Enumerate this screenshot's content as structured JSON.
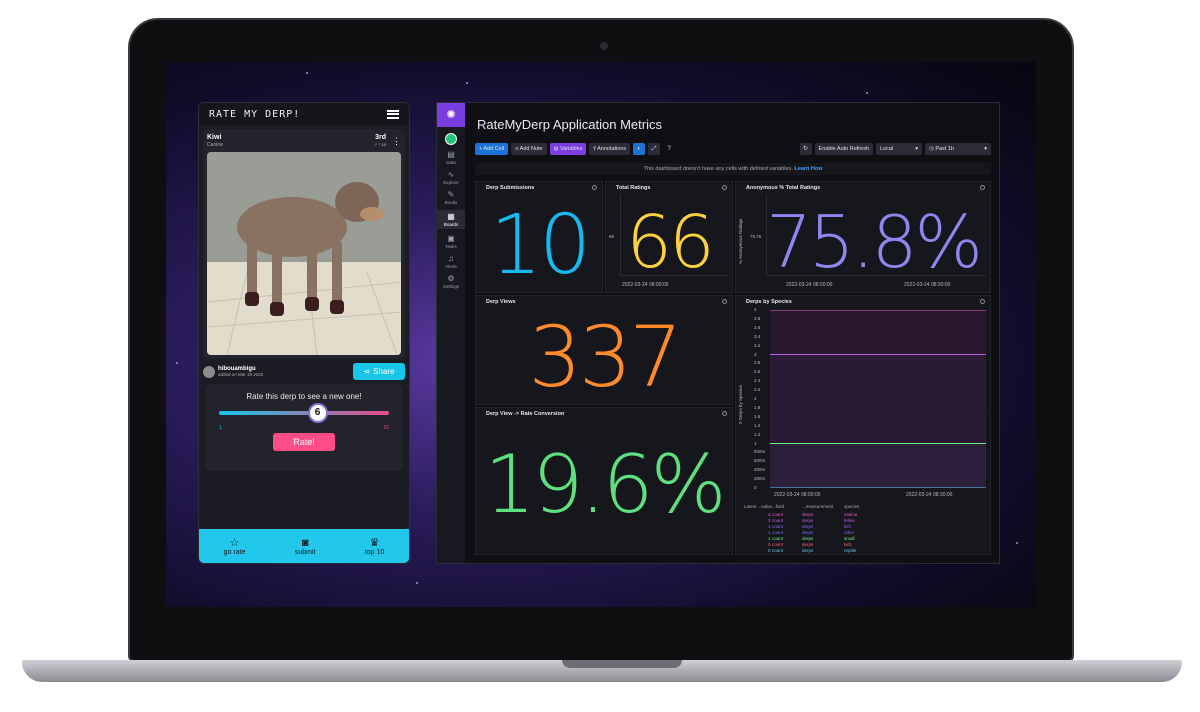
{
  "app": {
    "brand": "RATE MY DERP!",
    "pet": {
      "name": "Kiwi",
      "species": "Canine",
      "rank": "3rd",
      "rank_sub": "↗ 7.48"
    },
    "owner": {
      "name": "hibouambigu",
      "date": "added on Mar 19 2022"
    },
    "share_label": "Share",
    "rate_prompt": "Rate this derp to see a new one!",
    "rating_value": "6",
    "rating_fraction": 0.56,
    "slider_min": "1",
    "slider_max": "10",
    "rate_button": "Rate!",
    "tabs": [
      {
        "label": "go rate",
        "icon": "star-icon"
      },
      {
        "label": "submit",
        "icon": "camera-icon"
      },
      {
        "label": "top 10",
        "icon": "trophy-icon"
      }
    ]
  },
  "dashboard": {
    "title": "RateMyDerp Application Metrics",
    "nav": [
      {
        "label": "Data",
        "icon": "database-icon"
      },
      {
        "label": "Explore",
        "icon": "graph-icon"
      },
      {
        "label": "Books",
        "icon": "notebook-icon"
      },
      {
        "label": "Boards",
        "icon": "dashboard-icon"
      },
      {
        "label": "Tasks",
        "icon": "calendar-icon"
      },
      {
        "label": "Alerts",
        "icon": "bell-icon"
      },
      {
        "label": "Settings",
        "icon": "wrench-icon"
      }
    ],
    "toolbar": {
      "add_cell": "Add Cell",
      "add_note": "Add Note",
      "variables": "Variables",
      "annotations": "Annotations",
      "auto_refresh": "Enable Auto Refresh",
      "timezone": "Local",
      "range": "Past 1h"
    },
    "notice": "This dashboard doesn't have any cells with defined variables.",
    "notice_link": "Learn How",
    "cells": {
      "submissions": {
        "title": "Derp Submissions",
        "value": "10",
        "color": "#18b8f0"
      },
      "total_ratings": {
        "title": "Total Ratings",
        "value": "66",
        "color": "#ffd23d",
        "y_tick": "66",
        "x_tick": "2022-03-24 08:00:00"
      },
      "anon_pct": {
        "title": "Anonymous % Total Ratings",
        "value": "75.8%",
        "color": "#8f86f0",
        "ylabel": "% Anonymous Ratings",
        "y_tick": "75.76",
        "x_tick1": "2022-03-24 08:00:00",
        "x_tick2": "2022-03-24 08:30:00"
      },
      "views": {
        "title": "Derp Views",
        "value": "337",
        "color": "#ff8a2b"
      },
      "conversion": {
        "title": "Derp View -> Rate Conversion",
        "value": "19.6%",
        "color": "#5fe07e"
      },
      "species": {
        "title": "Derps by Species",
        "ylabel": "# Derps by Species",
        "y_ticks": [
          "4",
          "3.8",
          "3.6",
          "3.4",
          "3.2",
          "3",
          "2.8",
          "2.6",
          "2.4",
          "2.2",
          "2",
          "1.8",
          "1.6",
          "1.4",
          "1.2",
          "1",
          "800m",
          "600m",
          "400m",
          "200m",
          "0"
        ],
        "x_tick1": "2022-03-24 08:00:00",
        "x_tick2": "2022-03-24 08:30:00",
        "legend_headers": [
          "Latest ...value",
          "...field",
          "...measurement",
          "species"
        ],
        "legend": [
          {
            "value": "4",
            "field": "count",
            "measurement": "derps",
            "species": "canine",
            "color": "#e85cc8"
          },
          {
            "value": "3",
            "field": "count",
            "measurement": "derps",
            "species": "feline",
            "color": "#c060e8"
          },
          {
            "value": "1",
            "field": "count",
            "measurement": "derps",
            "species": "fish",
            "color": "#9a66f0"
          },
          {
            "value": "1",
            "field": "count",
            "measurement": "derps",
            "species": "other",
            "color": "#7b70f0"
          },
          {
            "value": "1",
            "field": "count",
            "measurement": "derps",
            "species": "small",
            "color": "#6cf07e"
          },
          {
            "value": "0",
            "field": "count",
            "measurement": "derps",
            "species": "birb",
            "color": "#ff5f7a"
          },
          {
            "value": "0",
            "field": "count",
            "measurement": "derps",
            "species": "reptile",
            "color": "#5ec8f0"
          }
        ]
      }
    }
  }
}
